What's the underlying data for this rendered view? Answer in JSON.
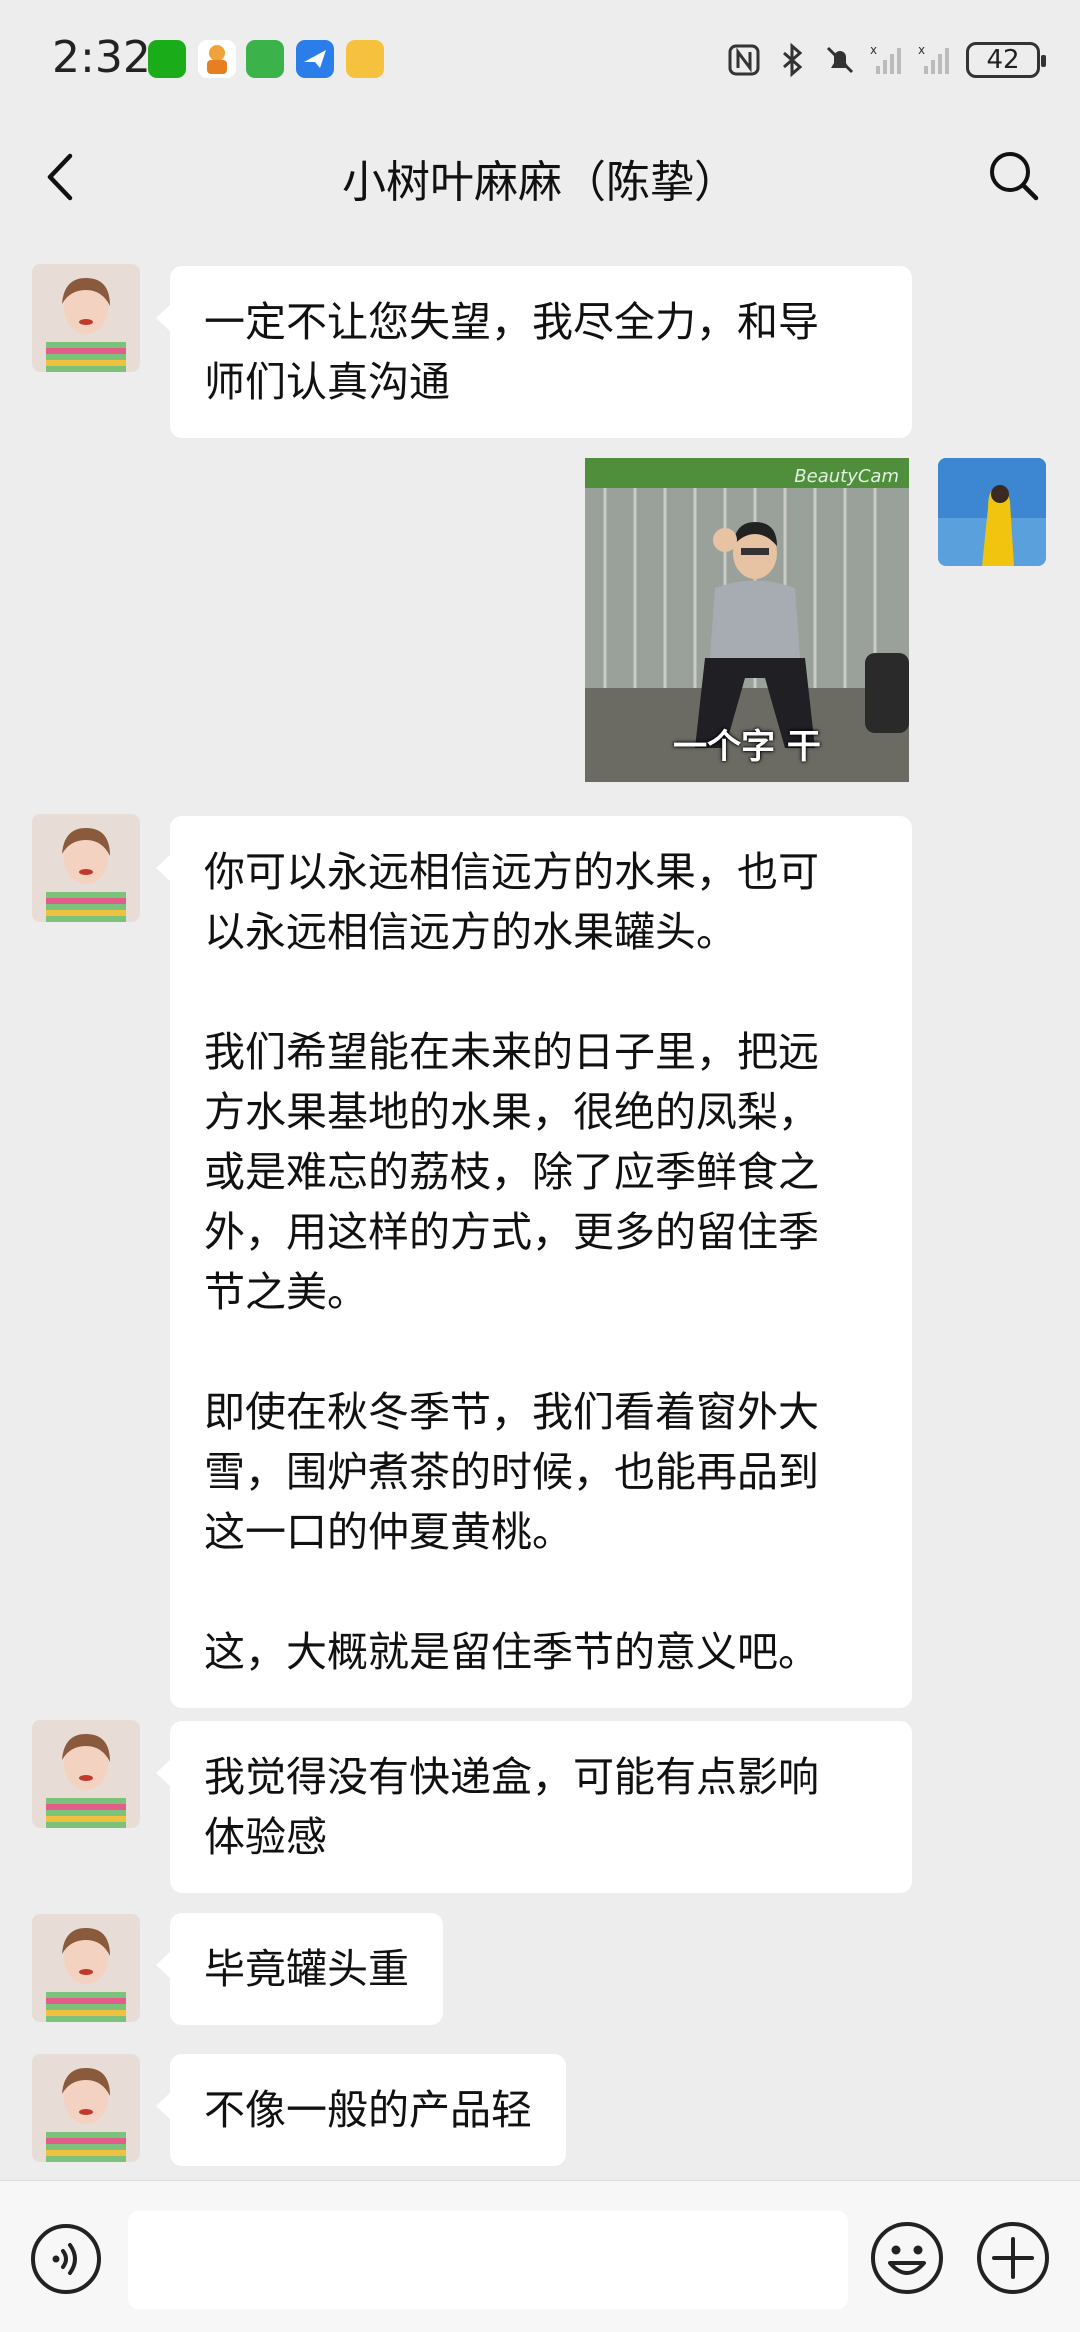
{
  "status_bar": {
    "time": "2:32",
    "battery": "42",
    "app_icons": [
      {
        "name": "app-icon-green",
        "color": "#1aad19"
      },
      {
        "name": "app-icon-orange",
        "color": "#f2a23a"
      },
      {
        "name": "app-icon-green-square",
        "color": "#3cb34a"
      },
      {
        "name": "app-icon-blue-plane",
        "color": "#2b7de9"
      },
      {
        "name": "app-icon-yellow-duck",
        "color": "#f6c23e"
      }
    ]
  },
  "header": {
    "title": "小树叶麻麻（陈挚）"
  },
  "messages": [
    {
      "side": "left",
      "type": "text",
      "text": "一定不让您失望，我尽全力，和导\n师们认真沟通"
    },
    {
      "side": "right",
      "type": "image",
      "caption": "一个字 干",
      "watermark": "BeautyCam"
    },
    {
      "side": "left",
      "type": "text",
      "text": "你可以永远相信远方的水果，也可\n以永远相信远方的水果罐头。\n\n我们希望能在未来的日子里，把远\n方水果基地的水果，很绝的凤梨，\n或是难忘的荔枝，除了应季鲜食之\n外，用这样的方式，更多的留住季\n节之美。\n\n即使在秋冬季节，我们看着窗外大\n雪，围炉煮茶的时候，也能再品到\n这一口的仲夏黄桃。\n\n这，大概就是留住季节的意义吧。"
    },
    {
      "side": "left",
      "type": "text",
      "text": "我觉得没有快递盒，可能有点影响\n体验感"
    },
    {
      "side": "left",
      "type": "text",
      "text": "毕竟罐头重"
    },
    {
      "side": "left",
      "type": "text",
      "text": "不像一般的产品轻"
    }
  ],
  "input_bar": {
    "placeholder": ""
  },
  "colors": {
    "background": "#ededed",
    "bubble_left": "#ffffff",
    "input_bar": "#f7f7f7"
  }
}
